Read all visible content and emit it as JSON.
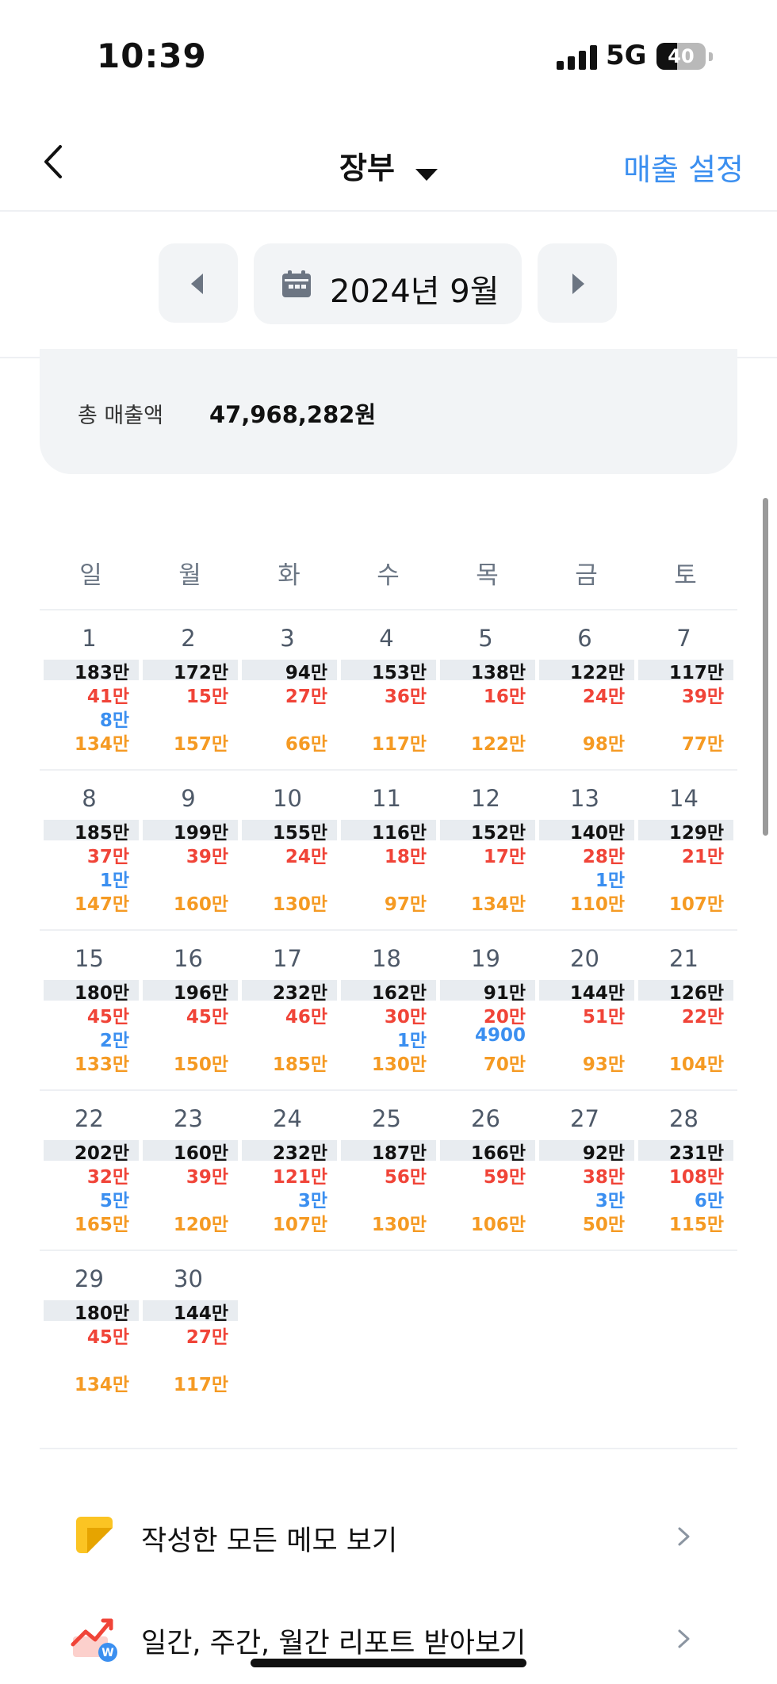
{
  "status_bar": {
    "time": "10:39",
    "network": "5G",
    "battery": "40"
  },
  "header": {
    "title": "장부",
    "settings_label": "매출 설정"
  },
  "month": "2024년 9월",
  "summary": {
    "label": "총 매출액",
    "value": "47,968,282원"
  },
  "days_of_week": [
    "일",
    "월",
    "화",
    "수",
    "목",
    "금",
    "토"
  ],
  "weeks": [
    [
      {
        "day": "1",
        "values": [
          "183만",
          "41만",
          "8만",
          "134만"
        ]
      },
      {
        "day": "2",
        "values": [
          "172만",
          "15만",
          "",
          "157만"
        ]
      },
      {
        "day": "3",
        "values": [
          "94만",
          "27만",
          "",
          "66만"
        ]
      },
      {
        "day": "4",
        "values": [
          "153만",
          "36만",
          "",
          "117만"
        ]
      },
      {
        "day": "5",
        "values": [
          "138만",
          "16만",
          "",
          "122만"
        ]
      },
      {
        "day": "6",
        "values": [
          "122만",
          "24만",
          "",
          "98만"
        ]
      },
      {
        "day": "7",
        "values": [
          "117만",
          "39만",
          "",
          "77만"
        ]
      }
    ],
    [
      {
        "day": "8",
        "values": [
          "185만",
          "37만",
          "1만",
          "147만"
        ]
      },
      {
        "day": "9",
        "values": [
          "199만",
          "39만",
          "",
          "160만"
        ]
      },
      {
        "day": "10",
        "values": [
          "155만",
          "24만",
          "",
          "130만"
        ]
      },
      {
        "day": "11",
        "values": [
          "116만",
          "18만",
          "",
          "97만"
        ]
      },
      {
        "day": "12",
        "values": [
          "152만",
          "17만",
          "",
          "134만"
        ]
      },
      {
        "day": "13",
        "values": [
          "140만",
          "28만",
          "1만",
          "110만"
        ]
      },
      {
        "day": "14",
        "values": [
          "129만",
          "21만",
          "",
          "107만"
        ]
      }
    ],
    [
      {
        "day": "15",
        "values": [
          "180만",
          "45만",
          "2만",
          "133만"
        ]
      },
      {
        "day": "16",
        "values": [
          "196만",
          "45만",
          "",
          "150만"
        ]
      },
      {
        "day": "17",
        "values": [
          "232만",
          "46만",
          "",
          "185만"
        ]
      },
      {
        "day": "18",
        "values": [
          "162만",
          "30만",
          "1만",
          "130만"
        ]
      },
      {
        "day": "19",
        "values": [
          "91만",
          "20만",
          "4900",
          "70만"
        ]
      },
      {
        "day": "20",
        "values": [
          "144만",
          "51만",
          "",
          "93만"
        ]
      },
      {
        "day": "21",
        "values": [
          "126만",
          "22만",
          "",
          "104만"
        ]
      }
    ],
    [
      {
        "day": "22",
        "values": [
          "202만",
          "32만",
          "5만",
          "165만"
        ]
      },
      {
        "day": "23",
        "values": [
          "160만",
          "39만",
          "",
          "120만"
        ]
      },
      {
        "day": "24",
        "values": [
          "232만",
          "121만",
          "3만",
          "107만"
        ]
      },
      {
        "day": "25",
        "values": [
          "187만",
          "56만",
          "",
          "130만"
        ]
      },
      {
        "day": "26",
        "values": [
          "166만",
          "59만",
          "",
          "106만"
        ]
      },
      {
        "day": "27",
        "values": [
          "92만",
          "38만",
          "3만",
          "50만"
        ]
      },
      {
        "day": "28",
        "values": [
          "231만",
          "108만",
          "6만",
          "115만"
        ]
      }
    ],
    [
      {
        "day": "29",
        "values": [
          "180만",
          "45만",
          "",
          "134만"
        ]
      },
      {
        "day": "30",
        "values": [
          "144만",
          "27만",
          "",
          "117만"
        ]
      }
    ]
  ],
  "menu": {
    "memo_label": "작성한 모든 메모 보기",
    "report_label": "일간, 주간, 월간 리포트 받아보기"
  },
  "colors": {
    "accent_blue": "#3b8ff0",
    "red": "#f04438",
    "orange": "#f59a23",
    "panel_bg": "#f2f4f6",
    "memo_yellow": "#fbc423"
  }
}
